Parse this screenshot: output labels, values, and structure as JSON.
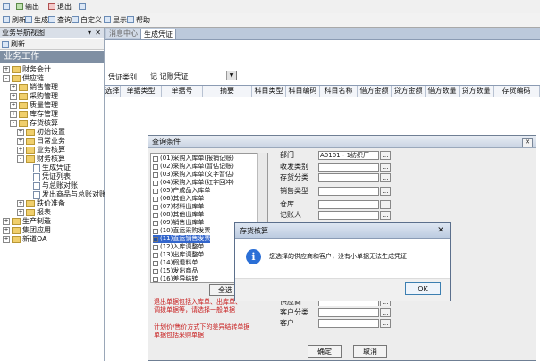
{
  "toolbar_top": {
    "items": [
      {
        "label": "",
        "icon": "app-icon"
      },
      {
        "label": "输出",
        "icon": "output-icon"
      },
      {
        "label": "退出",
        "icon": "exit-icon"
      },
      {
        "label": "",
        "icon": "help-icon"
      }
    ]
  },
  "toolbar": {
    "items": [
      {
        "label": "刷新",
        "icon": "refresh-icon"
      },
      {
        "label": "生成",
        "icon": "generate-icon"
      },
      {
        "label": "查询",
        "icon": "query-icon"
      },
      {
        "label": "自定义",
        "icon": "custom-icon"
      },
      {
        "label": "显示",
        "icon": "display-icon"
      },
      {
        "label": "帮助",
        "icon": "help-icon"
      }
    ]
  },
  "left_panel": {
    "title": "业务导航视图",
    "pin": "▾ ✕",
    "refresh_label": "刷新",
    "section": "业务工作",
    "tree": [
      {
        "level": 0,
        "label": "财务会计",
        "box": "+",
        "type": "folder"
      },
      {
        "level": 0,
        "label": "供应链",
        "box": "-",
        "type": "folder"
      },
      {
        "level": 1,
        "label": "销售管理",
        "box": "+",
        "type": "folder"
      },
      {
        "level": 1,
        "label": "采购管理",
        "box": "+",
        "type": "folder"
      },
      {
        "level": 1,
        "label": "质量管理",
        "box": "+",
        "type": "folder"
      },
      {
        "level": 1,
        "label": "库存管理",
        "box": "+",
        "type": "folder"
      },
      {
        "level": 1,
        "label": "存货核算",
        "box": "-",
        "type": "folder"
      },
      {
        "level": 2,
        "label": "初始设置",
        "box": "+",
        "type": "folder"
      },
      {
        "level": 2,
        "label": "日常业务",
        "box": "+",
        "type": "folder"
      },
      {
        "level": 2,
        "label": "业务核算",
        "box": "+",
        "type": "folder"
      },
      {
        "level": 2,
        "label": "财务核算",
        "box": "-",
        "type": "folder"
      },
      {
        "level": 3,
        "label": "生成凭证",
        "box": "",
        "type": "doc"
      },
      {
        "level": 3,
        "label": "凭证列表",
        "box": "",
        "type": "doc"
      },
      {
        "level": 3,
        "label": "与总账对账",
        "box": "",
        "type": "doc"
      },
      {
        "level": 3,
        "label": "发出商品与总账对账",
        "box": "",
        "type": "doc"
      },
      {
        "level": 2,
        "label": "跌价准备",
        "box": "+",
        "type": "folder"
      },
      {
        "level": 2,
        "label": "报表",
        "box": "+",
        "type": "folder"
      },
      {
        "level": 0,
        "label": "生产制造",
        "box": "+",
        "type": "folder"
      },
      {
        "level": 0,
        "label": "集团应用",
        "box": "+",
        "type": "folder"
      },
      {
        "level": 0,
        "label": "新道OA",
        "box": "+",
        "type": "folder"
      }
    ]
  },
  "tabs": [
    {
      "label": "消息中心"
    },
    {
      "label": "生成凭证"
    }
  ],
  "voucher": {
    "type_label": "凭证类别",
    "type_value": "记 记账凭证"
  },
  "grid": {
    "columns": [
      "选择",
      "单据类型",
      "单据号",
      "摘要",
      "科目类型",
      "科目编码",
      "科目名称",
      "借方金额",
      "贷方金额",
      "借方数量",
      "贷方数量",
      "存货编码"
    ]
  },
  "dialog": {
    "title": "查询条件",
    "close": "✕",
    "list": [
      {
        "label": "(01)采购入库单(报销记账)",
        "checked": false,
        "selected": false
      },
      {
        "label": "(02)采购入库单(暂估记账)",
        "checked": false,
        "selected": false
      },
      {
        "label": "(03)采购入库单(文字暂估)",
        "checked": false,
        "selected": false
      },
      {
        "label": "(04)采购入库单(红字回冲)",
        "checked": false,
        "selected": false
      },
      {
        "label": "(05)产成品入库单",
        "checked": false,
        "selected": false
      },
      {
        "label": "(06)其他入库单",
        "checked": false,
        "selected": false
      },
      {
        "label": "(07)材料出库单",
        "checked": false,
        "selected": false
      },
      {
        "label": "(08)其他出库单",
        "checked": false,
        "selected": false
      },
      {
        "label": "(09)销售出库单",
        "checked": false,
        "selected": false
      },
      {
        "label": "(10)直运采购发票",
        "checked": false,
        "selected": false
      },
      {
        "label": "(11)直运销售发票",
        "checked": true,
        "selected": true
      },
      {
        "label": "(12)入库调整单",
        "checked": false,
        "selected": false
      },
      {
        "label": "(13)出库调整单",
        "checked": false,
        "selected": false
      },
      {
        "label": "(14)假退料单",
        "checked": false,
        "selected": false
      },
      {
        "label": "(15)发出商品",
        "checked": false,
        "selected": false
      },
      {
        "label": "(16)差异结转",
        "checked": false,
        "selected": false
      }
    ],
    "select_all": "全选",
    "warnings": [
      "退出单据包括入库单、出库单、",
      "调拨单据等，请选择一般单据",
      "",
      "计划价/售价方式下的差异结转单据",
      "单据包括采购单据"
    ],
    "fields": [
      {
        "label": "部门",
        "value": "A0101 - 1纺织厂"
      },
      {
        "label": "收发类别",
        "value": ""
      },
      {
        "label": "存货分类",
        "value": ""
      },
      {
        "label": "销售类型",
        "value": ""
      },
      {
        "label": "仓库",
        "value": ""
      },
      {
        "label": "记账人",
        "value": ""
      },
      {
        "label": "供应商",
        "value": ""
      },
      {
        "label": "客户分类",
        "value": ""
      },
      {
        "label": "客户",
        "value": ""
      }
    ],
    "ok": "确定",
    "cancel": "取消"
  },
  "message": {
    "title": "存货核算",
    "close": "✕",
    "text": "您选择的供应商和客户，没有小单据无法生成凭证",
    "ok": "OK"
  }
}
